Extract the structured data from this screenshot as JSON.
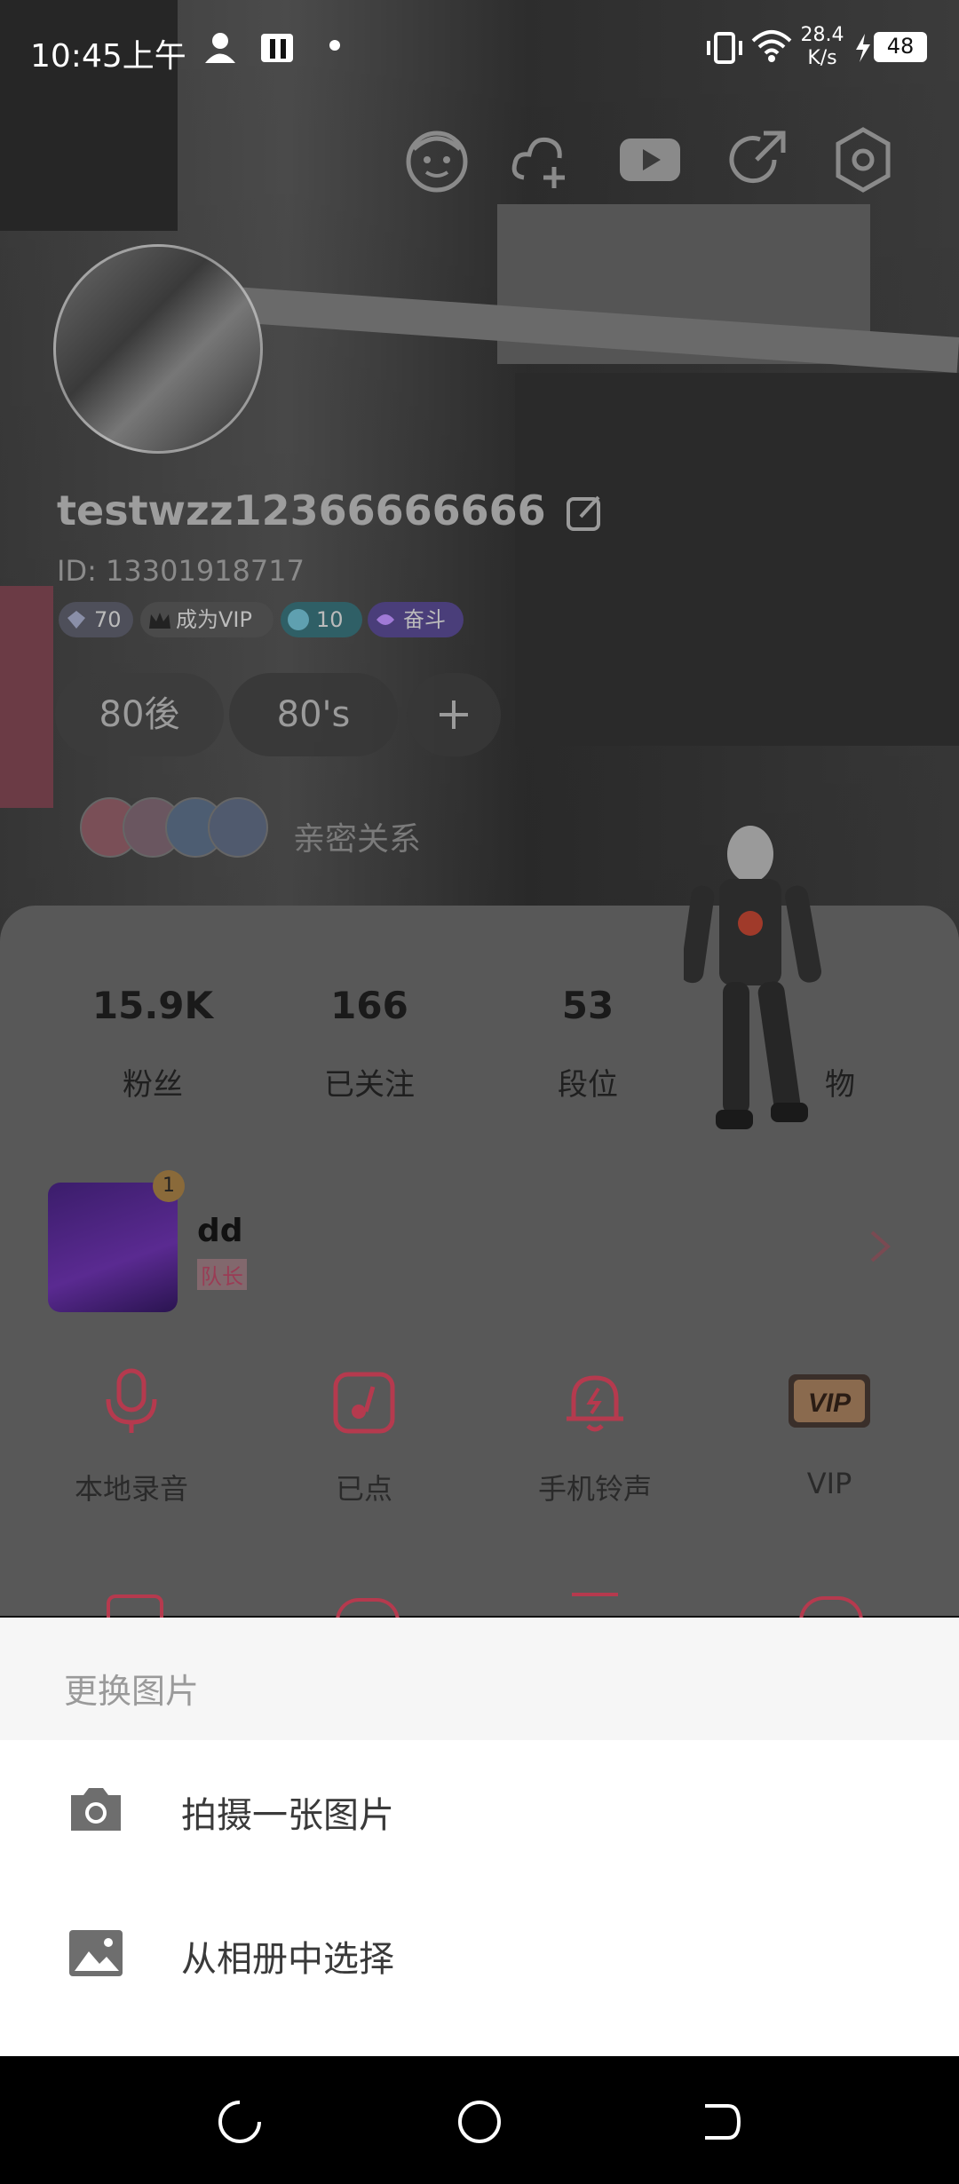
{
  "status_bar": {
    "time": "10:45上午",
    "net_speed_value": "28.4",
    "net_speed_unit": "K/s",
    "battery": "48"
  },
  "profile": {
    "username": "testwzz12366666666",
    "id_text": "ID: 13301918717",
    "badges": [
      {
        "label": "70",
        "color": "#8a8fa8"
      },
      {
        "label": "成为VIP",
        "color": "#7d7d7d"
      },
      {
        "label": "10",
        "color": "#3aa7b8"
      },
      {
        "label": "奋斗",
        "color": "#7a5bd6"
      }
    ],
    "tags": [
      "80後",
      "80's"
    ],
    "add_tag_icon": "plus-icon",
    "intimacy_label": "亲密关系"
  },
  "stats": [
    {
      "value": "15.9K",
      "label": "粉丝"
    },
    {
      "value": "166",
      "label": "已关注"
    },
    {
      "value": "53",
      "label": "段位"
    },
    {
      "value": "",
      "label": "物"
    }
  ],
  "room": {
    "name": "dd",
    "role": "队长",
    "rank_badge": "1"
  },
  "functions": [
    {
      "label": "本地录音",
      "icon": "microphone-icon"
    },
    {
      "label": "已点",
      "icon": "music-note-icon"
    },
    {
      "label": "手机铃声",
      "icon": "bell-icon"
    },
    {
      "label": "VIP",
      "icon": "vip-icon"
    }
  ],
  "sheet": {
    "title": "更换图片",
    "options": [
      {
        "label": "拍摄一张图片",
        "icon": "camera-icon"
      },
      {
        "label": "从相册中选择",
        "icon": "gallery-icon"
      }
    ]
  },
  "colors": {
    "accent": "#c0364e",
    "overlay": "#585858",
    "sheet_bg": "#ffffff"
  }
}
